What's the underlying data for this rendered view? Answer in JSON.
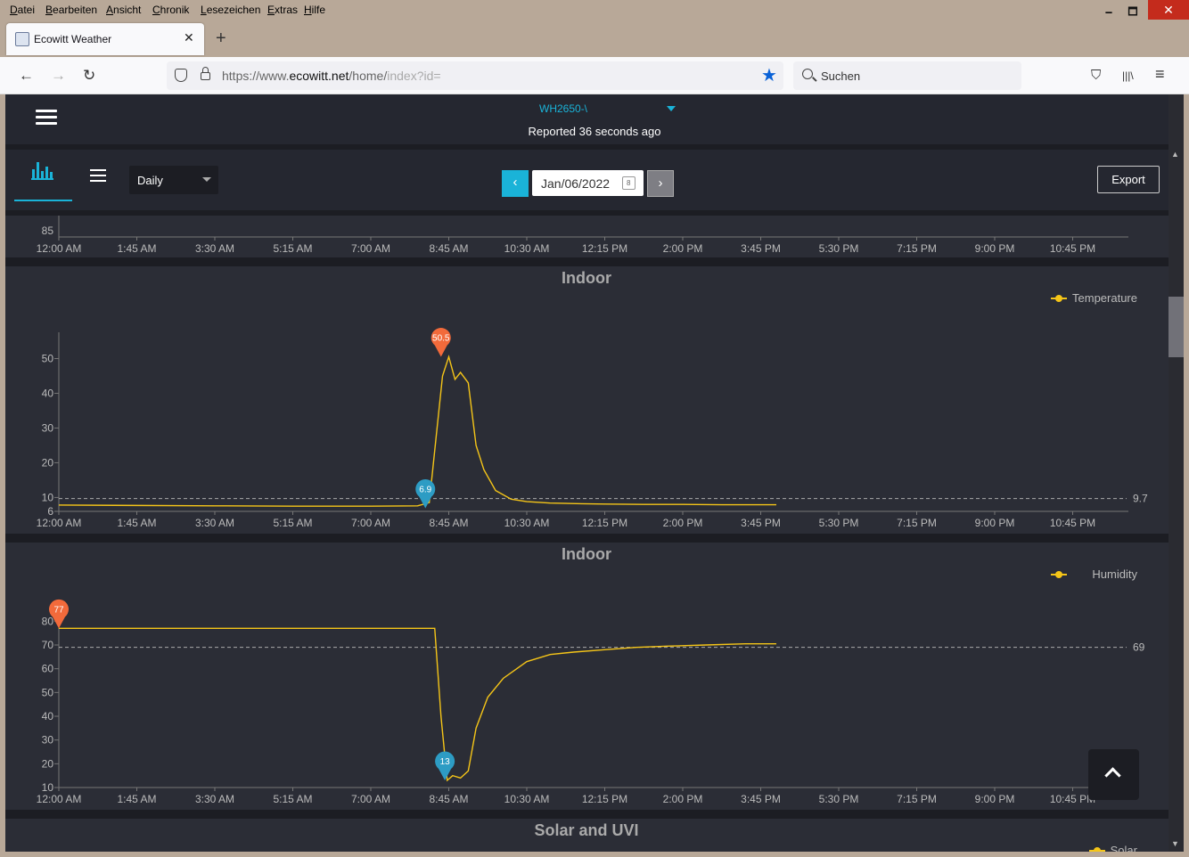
{
  "menubar": {
    "items": [
      {
        "label": "Datei",
        "accel": "D",
        "rest": "atei"
      },
      {
        "label": "Bearbeiten",
        "accel": "B",
        "rest": "earbeiten"
      },
      {
        "label": "Ansicht",
        "accel": "A",
        "rest": "nsicht"
      },
      {
        "label": "Chronik",
        "accel": "C",
        "rest": "hronik"
      },
      {
        "label": "Lesezeichen",
        "accel": "L",
        "rest": "esezeichen"
      },
      {
        "label": "Extras",
        "accel": "E",
        "rest": "xtras"
      },
      {
        "label": "Hilfe",
        "accel": "H",
        "rest": "ilfe"
      }
    ]
  },
  "window": {
    "minimize": "🗕",
    "maximize": "🗖",
    "close": "✕"
  },
  "tab": {
    "title": "Ecowitt Weather",
    "close": "✕",
    "newtab": "+"
  },
  "nav": {
    "back": "←",
    "forward": "→",
    "reload": "↻",
    "url_prefix": "https://www.",
    "url_domain": "ecowitt.net",
    "url_path": "/home/",
    "url_faded": "index?id=",
    "star": "★"
  },
  "search": {
    "placeholder": "Suchen"
  },
  "toolbar_icons": {
    "pocket": "⛉",
    "library": "|||\\",
    "menu": "≡"
  },
  "app": {
    "device": "WH2650-\\",
    "reported": "Reported 36 seconds ago",
    "range": "Daily",
    "date": "Jan/06/2022",
    "prev": "‹",
    "next": "›",
    "export": "Export",
    "calendar_day": "8"
  },
  "colors": {
    "accent": "#1ab3d8",
    "line": "#f5c518",
    "max_marker": "#f26a3b",
    "min_marker": "#2d9cc4",
    "panel": "#2b2d36",
    "page": "#1c1d23"
  },
  "x_ticks": [
    "12:00 AM",
    "1:45 AM",
    "3:30 AM",
    "5:15 AM",
    "7:00 AM",
    "8:45 AM",
    "10:30 AM",
    "12:15 PM",
    "2:00 PM",
    "3:45 PM",
    "5:30 PM",
    "7:15 PM",
    "9:00 PM",
    "10:45 PM"
  ],
  "chart_data": [
    {
      "type": "line",
      "title": "",
      "y_ticks": [
        "85"
      ],
      "x_ticks_ref": "x_ticks"
    },
    {
      "type": "line",
      "title": "Indoor",
      "legend": "Temperature",
      "legend_position": "top-right",
      "ylim": [
        6,
        55
      ],
      "y_ticks": [
        "50",
        "40",
        "30",
        "20",
        "10",
        "6"
      ],
      "avg": 9.7,
      "avg_label": "9.7",
      "max": {
        "x": 4.9,
        "value": 50.5,
        "label": "50.5"
      },
      "min": {
        "x": 4.7,
        "value": 6.9,
        "label": "6.9"
      },
      "series": [
        {
          "name": "Temperature",
          "x": [
            0,
            1,
            2,
            3,
            4,
            4.6,
            4.75,
            4.85,
            4.92,
            5.0,
            5.08,
            5.15,
            5.25,
            5.35,
            5.45,
            5.6,
            5.8,
            6.0,
            6.3,
            6.7,
            7.0,
            7.5,
            8.0,
            8.5,
            9.0,
            9.2
          ],
          "values": [
            7.8,
            7.7,
            7.6,
            7.5,
            7.5,
            7.6,
            8.5,
            30,
            45,
            50.5,
            44,
            46,
            43,
            25,
            18,
            12,
            9.5,
            8.8,
            8.4,
            8.2,
            8.1,
            8.0,
            8.0,
            7.9,
            7.9,
            7.9
          ]
        }
      ]
    },
    {
      "type": "line",
      "title": "Indoor",
      "legend": "Humidity",
      "legend_position": "top-right",
      "ylim": [
        10,
        85
      ],
      "y_ticks": [
        "80",
        "70",
        "60",
        "50",
        "40",
        "30",
        "20",
        "10"
      ],
      "avg": 69,
      "avg_label": "69",
      "max": {
        "x": 0,
        "value": 77,
        "label": "77"
      },
      "min": {
        "x": 4.95,
        "value": 13,
        "label": "13"
      },
      "series": [
        {
          "name": "Humidity",
          "x": [
            0,
            1,
            2,
            3,
            4,
            4.82,
            4.9,
            4.98,
            5.05,
            5.15,
            5.25,
            5.35,
            5.5,
            5.7,
            6.0,
            6.3,
            6.6,
            7.0,
            7.4,
            7.8,
            8.3,
            8.8,
            9.2
          ],
          "values": [
            77,
            77,
            77,
            77,
            77,
            77,
            40,
            13,
            15,
            14,
            17,
            35,
            48,
            56,
            63,
            66,
            67,
            68,
            69,
            69.5,
            70,
            70.5,
            70.5
          ]
        }
      ]
    },
    {
      "type": "line",
      "title": "Solar and UVI",
      "legend": "Solar",
      "legend_position": "top-right"
    }
  ]
}
